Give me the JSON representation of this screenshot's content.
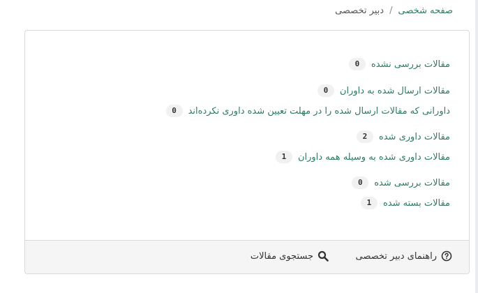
{
  "breadcrumb": {
    "home": "صفحه شخصی",
    "separator": "/",
    "current": "دبیر تخصصی"
  },
  "stats": [
    {
      "label": "مقالات بررسی نشده",
      "count": "0"
    },
    {
      "label": "مقالات ارسال شده به داوران",
      "count": "0"
    },
    {
      "label": "داورانی که مقالات ارسال شده را در مهلت تعیین شده داوری نکرده‌اند",
      "count": "0"
    },
    {
      "label": "مقالات داوری شده",
      "count": "2"
    },
    {
      "label": "مقالات داوری شده به وسیله همه داوران",
      "count": "1"
    },
    {
      "label": "مقالات بررسی شده",
      "count": "0"
    },
    {
      "label": "مقالات بسته شده",
      "count": "1"
    }
  ],
  "footer": {
    "guide_label": "راهنمای دبیر تخصصی",
    "guide_icon": "question-circle-icon",
    "search_label": "جستجوی مقالات",
    "search_icon": "search-icon"
  },
  "colors": {
    "link": "#2d7a62",
    "badge_bg": "#f1f1f1",
    "footer_bg": "#f5f5f5"
  }
}
